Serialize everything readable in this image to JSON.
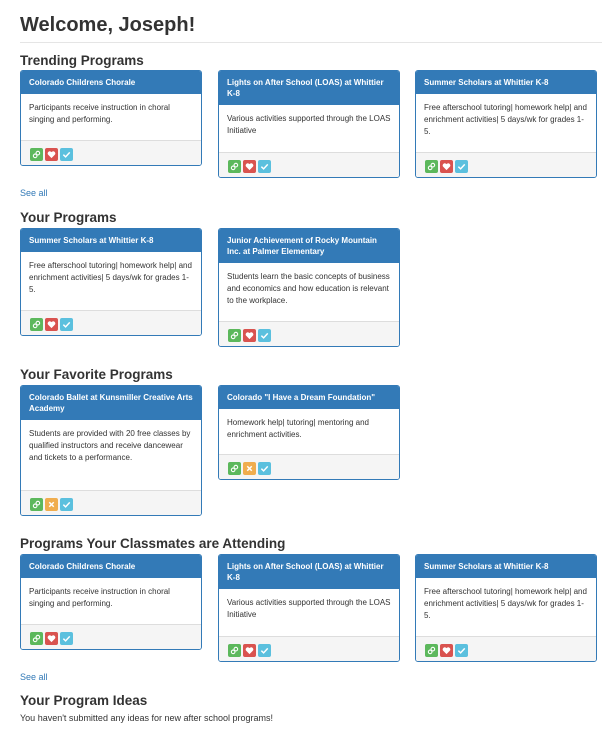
{
  "header": {
    "welcome": "Welcome, Joseph!"
  },
  "sections": {
    "trending": {
      "title": "Trending Programs",
      "see_all": "See all"
    },
    "your_programs": {
      "title": "Your Programs"
    },
    "favorites": {
      "title": "Your Favorite Programs"
    },
    "classmates": {
      "title": "Programs Your Classmates are Attending",
      "see_all": "See all"
    },
    "ideas": {
      "title": "Your Program Ideas",
      "message": "You haven't submitted any ideas for new after school programs!"
    }
  },
  "cards": {
    "trending": [
      {
        "title": "Colorado Childrens Chorale",
        "description": "Participants receive instruction in choral singing and performing."
      },
      {
        "title": "Lights on After School (LOAS) at Whittier K-8",
        "description": "Various activities supported through the LOAS Initiative"
      },
      {
        "title": "Summer Scholars at Whittier K-8",
        "description": "Free afterschool tutoring| homework help| and enrichment activities| 5 days/wk for grades 1-5."
      }
    ],
    "your_programs": [
      {
        "title": "Summer Scholars at Whittier K-8",
        "description": "Free afterschool tutoring| homework help| and enrichment activities| 5 days/wk for grades 1-5."
      },
      {
        "title": "Junior Achievement of Rocky Mountain Inc. at Palmer Elementary",
        "description": "Students learn the basic concepts of business and economics and how education is relevant to the workplace."
      }
    ],
    "favorites": [
      {
        "title": "Colorado Ballet at Kunsmiller Creative Arts Academy",
        "description": "Students are provided with 20 free classes by qualified instructors and receive dancewear and tickets to a performance."
      },
      {
        "title": "Colorado \"I Have a Dream Foundation\"",
        "description": "Homework help| tutoring| mentoring and enrichment activities."
      }
    ],
    "classmates": [
      {
        "title": "Colorado Childrens Chorale",
        "description": "Participants receive instruction in choral singing and performing."
      },
      {
        "title": "Lights on After School (LOAS) at Whittier K-8",
        "description": "Various activities supported through the LOAS Initiative"
      },
      {
        "title": "Summer Scholars at Whittier K-8",
        "description": "Free afterschool tutoring| homework help| and enrichment activities| 5 days/wk for grades 1-5."
      }
    ]
  },
  "icons": {
    "link": "link-icon",
    "favorite": "heart-icon",
    "unfavorite": "x-icon",
    "attend": "check-icon"
  },
  "colors": {
    "primary": "#337ab7",
    "link_button": "#5cb85c",
    "favorite_button": "#d9534f",
    "unfavorite_button": "#f0ad4e",
    "attend_button": "#5bc0de"
  }
}
